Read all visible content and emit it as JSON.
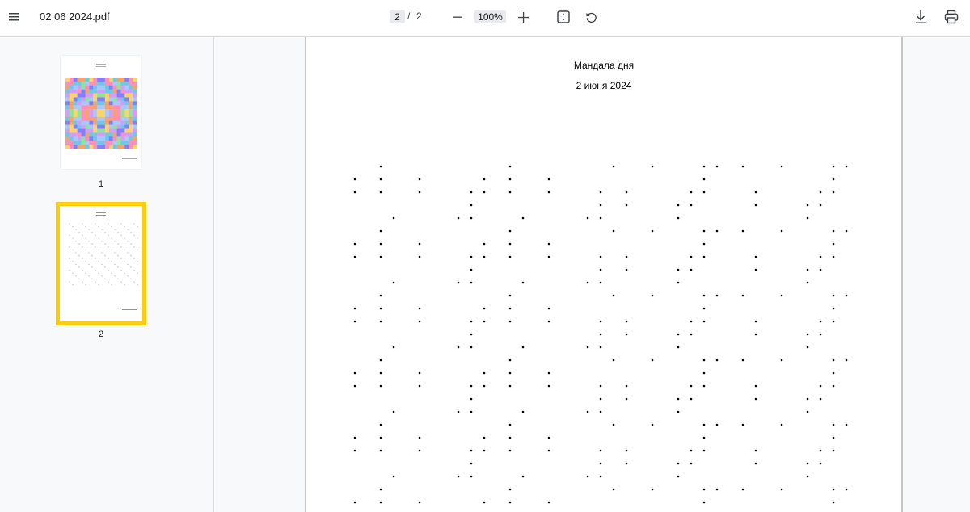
{
  "toolbar": {
    "menu_icon": "hamburger-menu-icon",
    "title": "02 06 2024.pdf",
    "page_current": "2",
    "page_separator": "/",
    "page_total": "2",
    "zoom_out_icon": "minus-icon",
    "zoom_level": "100%",
    "zoom_in_icon": "plus-icon",
    "fit_icon": "fit-to-page-icon",
    "rotate_icon": "rotate-counterclockwise-icon",
    "download_icon": "download-icon",
    "print_icon": "print-icon"
  },
  "sidebar": {
    "thumbnails": [
      {
        "label": "1",
        "selected": false
      },
      {
        "label": "2",
        "selected": true
      }
    ],
    "selected_color": "#fccc0e"
  },
  "document": {
    "heading": "Мандала дня",
    "date": "2 июня 2024"
  },
  "colors": {
    "toolbar_bg": "#ffffff",
    "sidebar_bg": "#f8f9fa",
    "page_bg": "#ffffff",
    "dot_color": "#000000"
  }
}
